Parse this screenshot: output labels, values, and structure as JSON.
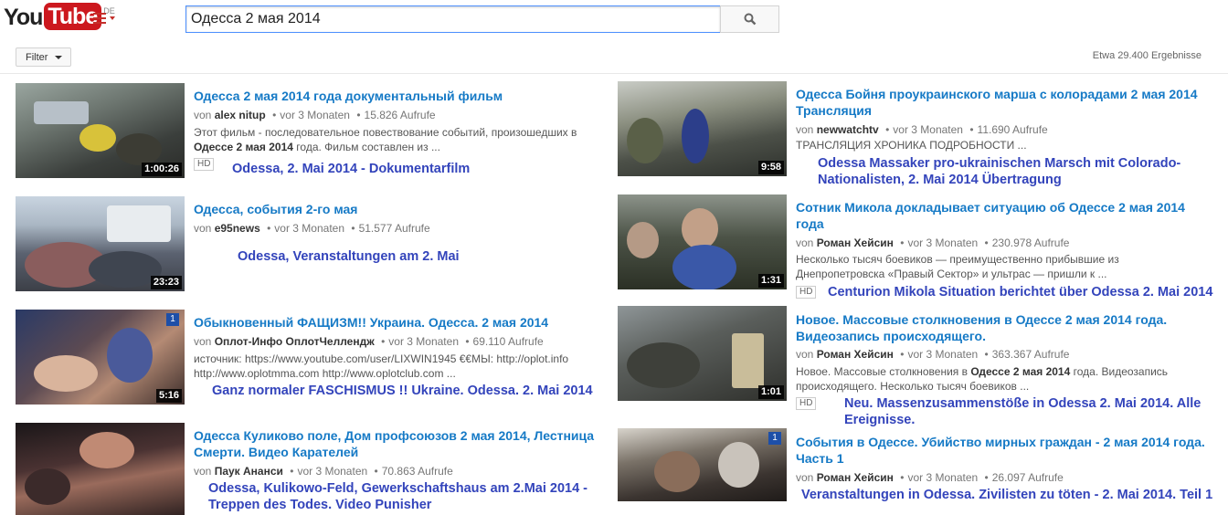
{
  "header": {
    "logo_you": "You",
    "logo_tube": "Tube",
    "logo_region": "DE",
    "search_value": "Одесса 2 мая 2014"
  },
  "subbar": {
    "filter_label": "Filter",
    "result_count": "Etwa 29.400 Ergebnisse"
  },
  "results": [
    {
      "title": "Одесса 2 мая 2014 года документальный фильм",
      "author": "alex nitup",
      "age": "vor 3 Monaten",
      "views": "15.826 Aufrufe",
      "desc1": "Этот фильм - последовательное повествование событий, произошедших в",
      "desc2_bold": "Одессе 2 мая 2014",
      "desc2_rest": " года. Фильм составлен из ...",
      "duration": "1:00:26",
      "hd": "HD",
      "overlay": "Odessa, 2. Mai 2014 - Dokumentarfilm"
    },
    {
      "title": "Одесса, события 2-го мая",
      "author": "e95news",
      "age": "vor 3 Monaten",
      "views": "51.577 Aufrufe",
      "duration": "23:23",
      "overlay": "Odessa, Veranstaltungen am 2. Mai"
    },
    {
      "title": "Обыкновенный ФАЩИЗМ!! Украина. Одесса. 2 мая 2014",
      "author": "Оплот-Инфо ОплотЧеллендж",
      "age": "vor 3 Monaten",
      "views": "69.110 Aufrufe",
      "desc1": "источник: https://www.youtube.com/user/LIXWIN1945 €€МЫ: http://oplot.info",
      "desc2_rest": "http://www.oplotmma.com http://www.oplotclub.com ...",
      "duration": "5:16",
      "overlay": "Ganz normaler FASCHISMUS !! Ukraine. Odessa. 2. Mai 2014"
    },
    {
      "title1": "Одесса Куликово поле, Дом профсоюзов 2 мая 2014, Лестница",
      "title2": "Смерти. Видео Карателей",
      "author": "Паук Ананси",
      "age": "vor 3 Monaten",
      "views": "70.863 Aufrufe",
      "overlay1": "Odessa, Kulikowo-Feld, Gewerkschaftshaus am 2.Mai 2014 -",
      "overlay2": "Treppen des Todes. Video Punisher"
    },
    {
      "title1": "Одесса Бойня проукраинского марша с колорадами 2 мая 2014",
      "title2": "Трансляция",
      "author": "newwatchtv",
      "age": "vor 3 Monaten",
      "views": "11.690 Aufrufe",
      "desc1": "ТРАНСЛЯЦИЯ ХРОНИКА ПОДРОБНОСТИ ...",
      "duration": "9:58",
      "overlay1": "Odessa Massaker pro-ukrainischen Marsch mit Colorado-",
      "overlay2": "Nationalisten, 2. Mai 2014 Übertragung"
    },
    {
      "title1": "Сотник Микола докладывает ситуацию об Одессе 2 мая 2014",
      "title2": "года",
      "author": "Роман Хейсин",
      "age": "vor 3 Monaten",
      "views": "230.978 Aufrufe",
      "desc1": "Несколько тысяч боевиков — преимущественно прибывшие из",
      "desc2_rest": "Днепропетровска «Правый Сектор» и ультрас — пришли к ...",
      "duration": "1:31",
      "hd": "HD",
      "overlay": "Centurion Mikola Situation berichtet über Odessa 2. Mai 2014"
    },
    {
      "title1": "Новое. Массовые столкновения в Одессе 2 мая 2014 года.",
      "title2": "Видеозапись происходящего.",
      "author": "Роман Хейсин",
      "age": "vor 3 Monaten",
      "views": "363.367 Aufrufe",
      "desc1_pre": "Новое. Массовые столкновения в ",
      "desc1_bold": "Одессе 2 мая 2014",
      "desc1_post": " года. Видеозапись",
      "desc2_rest": "происходящего. Несколько тысяч боевиков ...",
      "duration": "1:01",
      "hd": "HD",
      "overlay1": "Neu. Massenzusammenstöße in Odessa 2. Mai 2014. Alle",
      "overlay2": "Ereignisse."
    },
    {
      "title1": "События в Одессе. Убийство мирных граждан - 2 мая 2014 года.",
      "title2": "Часть 1",
      "author": "Роман Хейсин",
      "age": "vor 3 Monaten",
      "views": "26.097 Aufrufe",
      "overlay": "Veranstaltungen in Odessa. Zivilisten zu töten - 2. Mai 2014. Teil 1"
    }
  ],
  "labels": {
    "by": "von"
  }
}
